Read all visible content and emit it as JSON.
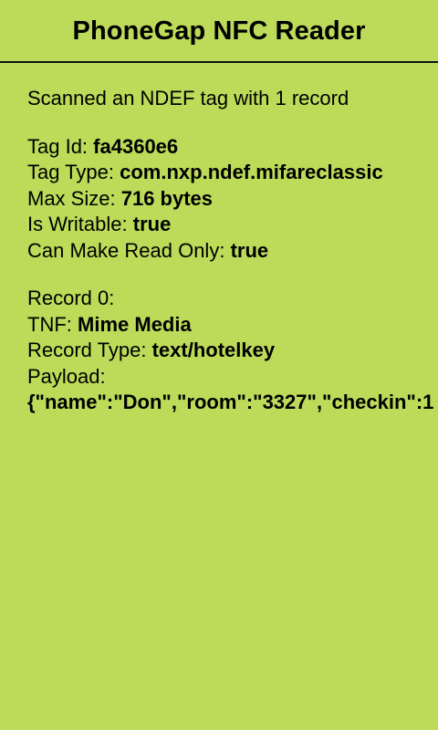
{
  "header": {
    "title": "PhoneGap NFC Reader"
  },
  "summary": "Scanned an NDEF tag with 1 record",
  "tag": {
    "id_label": "Tag Id:",
    "id_value": "fa4360e6",
    "type_label": "Tag Type:",
    "type_value": "com.nxp.ndef.mifareclassic",
    "max_size_label": "Max Size:",
    "max_size_value": "716 bytes",
    "writable_label": "Is Writable:",
    "writable_value": "true",
    "read_only_label": "Can Make Read Only:",
    "read_only_value": "true"
  },
  "record": {
    "heading": "Record 0:",
    "tnf_label": "TNF:",
    "tnf_value": "Mime Media",
    "type_label": "Record Type:",
    "type_value": "text/hotelkey",
    "payload_label": "Payload:",
    "payload_value": "{\"name\":\"Don\",\"room\":\"3327\",\"checkin\":1"
  },
  "colors": {
    "background": "#bddb59",
    "header_border": "#111111",
    "text": "#000000"
  }
}
